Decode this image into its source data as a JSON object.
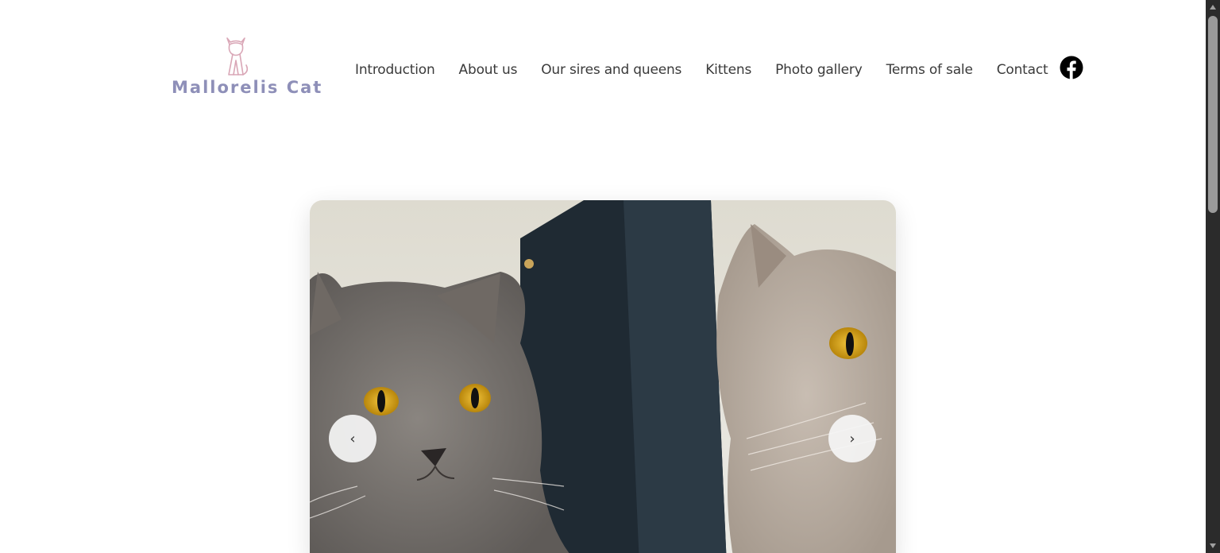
{
  "brand": {
    "name": "Mallorelis Cat",
    "logo_icon": "cat-outline-icon",
    "logo_color": "#d9a6b6",
    "text_color": "#8e8fb8"
  },
  "nav": {
    "items": [
      {
        "label": "Introduction"
      },
      {
        "label": "About us"
      },
      {
        "label": "Our sires and queens"
      },
      {
        "label": "Kittens"
      },
      {
        "label": "Photo gallery"
      },
      {
        "label": "Terms of sale"
      },
      {
        "label": "Contact"
      }
    ]
  },
  "social": {
    "icon": "facebook-icon"
  },
  "slider": {
    "image": "cats-photo",
    "prev_label": "‹",
    "next_label": "›"
  },
  "scrollbar": {
    "up_icon": "triangle-up-icon",
    "down_icon": "triangle-down-icon"
  }
}
